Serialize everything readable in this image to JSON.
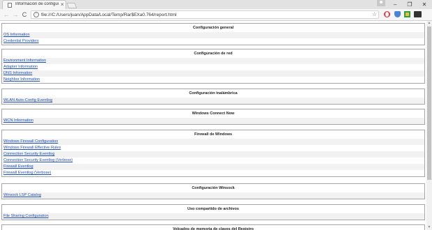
{
  "browser": {
    "tab_title": "Información de configur",
    "tab_close": "×",
    "url": "file:///C:/Users/juan/AppData/Local/Temp/Rar$EXa0.764/report.html",
    "back": "←",
    "forward": "→",
    "reload": "C",
    "info": "i",
    "star": "☆",
    "menu": "⋮",
    "minimize": "–",
    "maximize": "❐",
    "close": "✕"
  },
  "icons": {
    "tab": "document-icon",
    "profile": "user-icon",
    "extensions": [
      "opera-icon",
      "shield-extension-icon",
      "green-extension-icon",
      "dark-extension-icon"
    ]
  },
  "sections": [
    {
      "title": "Configuración general",
      "links": [
        "OS Information",
        "Credential Providers"
      ]
    },
    {
      "title": "Configuración de red",
      "links": [
        "Environment Information",
        "Adapter Information",
        "DNS Information",
        "Neighbor Information"
      ]
    },
    {
      "title": "Configuración inalámbrica",
      "links": [
        "WLAN Auto-Config Eventlog"
      ]
    },
    {
      "title": "Windows Connect Now",
      "links": [
        "WCN Information"
      ]
    },
    {
      "title": "Firewall de Windows",
      "links": [
        "Windows Firewall Configuration",
        "Windows Firewall Effective Rules",
        "Connection Security Eventlog",
        "Connection Security Eventlog (Verbose)",
        "Firewall Eventlog",
        "Firewall Eventlog (Verbose)"
      ]
    },
    {
      "title": "Configuración Winsock",
      "links": [
        "Winsock LSP Catalog"
      ]
    },
    {
      "title": "Uso compartido de archivos",
      "links": [
        "File Sharing Configuration"
      ]
    },
    {
      "title": "Volcados de memoria de claves del Registro",
      "links": []
    }
  ]
}
